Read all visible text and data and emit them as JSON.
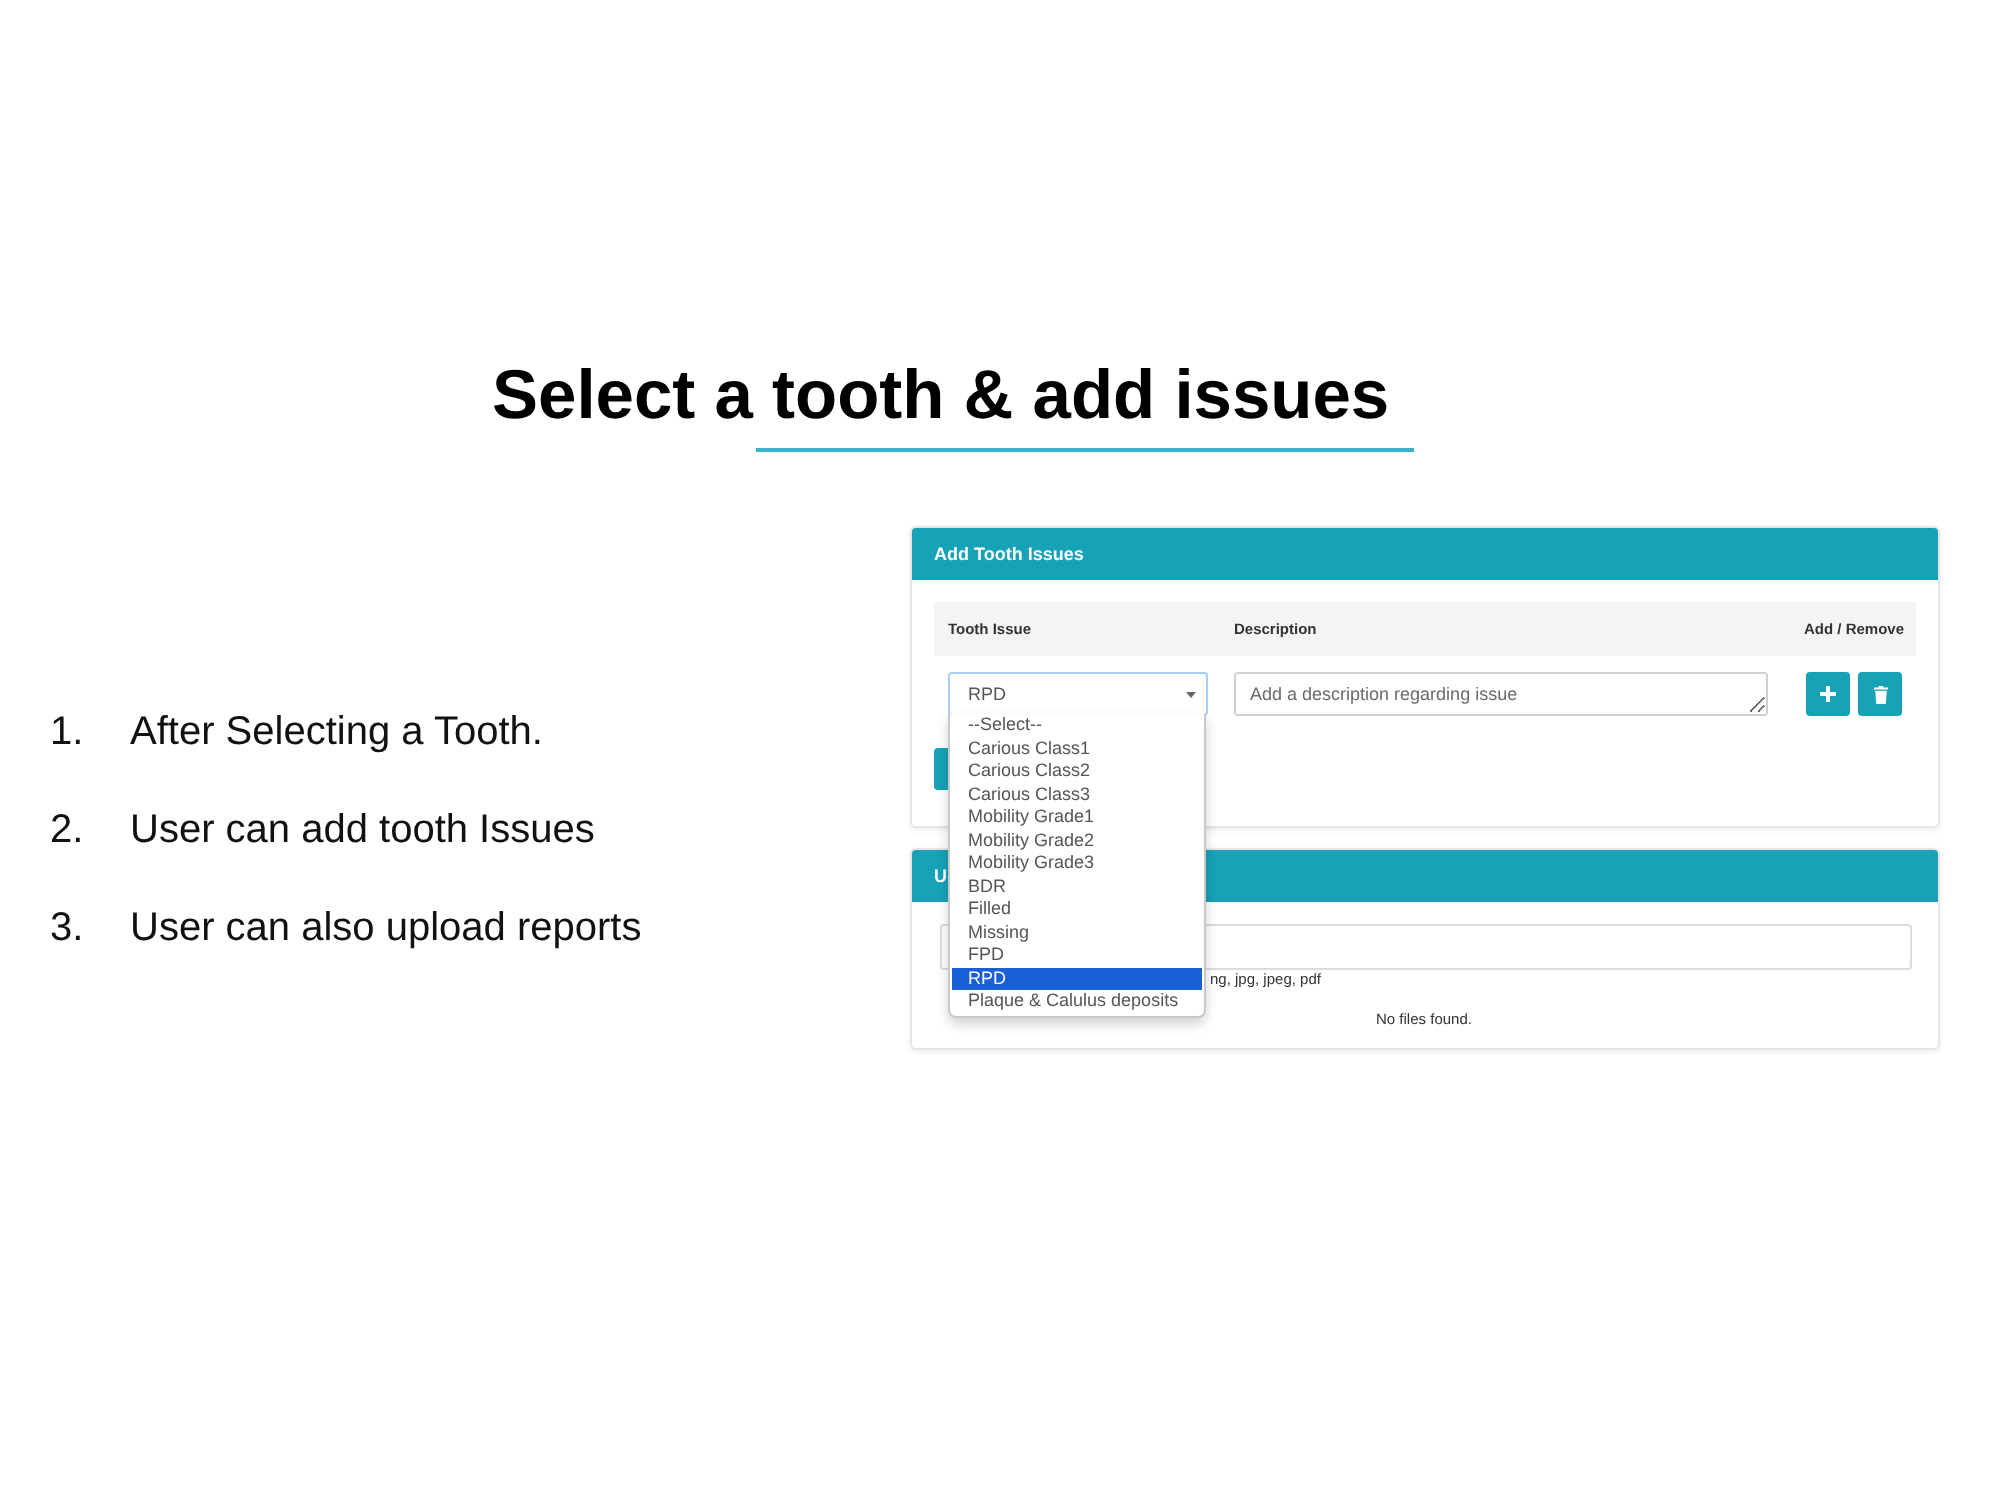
{
  "title": "Select a tooth & add issues",
  "steps": [
    {
      "number": "1.",
      "text": "After Selecting a Tooth."
    },
    {
      "number": "2.",
      "text": "User can add tooth Issues"
    },
    {
      "number": "3.",
      "text": "User can also upload reports"
    }
  ],
  "issues_card": {
    "title": "Add Tooth Issues",
    "columns": [
      "Tooth Issue",
      "Description",
      "Add / Remove"
    ],
    "tooth_issue": {
      "value": "RPD",
      "expanded": true,
      "options": [
        {
          "label": "--Select--",
          "selected": false
        },
        {
          "label": "Carious Class1",
          "selected": false
        },
        {
          "label": "Carious Class2",
          "selected": false
        },
        {
          "label": "Carious Class3",
          "selected": false
        },
        {
          "label": "Mobility Grade1",
          "selected": false
        },
        {
          "label": "Mobility Grade2",
          "selected": false
        },
        {
          "label": "Mobility Grade3",
          "selected": false
        },
        {
          "label": "BDR",
          "selected": false
        },
        {
          "label": "Filled",
          "selected": false
        },
        {
          "label": "Missing",
          "selected": false
        },
        {
          "label": "FPD",
          "selected": false
        },
        {
          "label": "RPD",
          "selected": true
        },
        {
          "label": "Plaque & Calulus deposits",
          "selected": false
        }
      ]
    },
    "description": {
      "placeholder": "Add a description regarding issue"
    }
  },
  "upload_card": {
    "title": "U",
    "file_types": "ng, jpg, jpeg, pdf",
    "empty_message": "No files found."
  }
}
